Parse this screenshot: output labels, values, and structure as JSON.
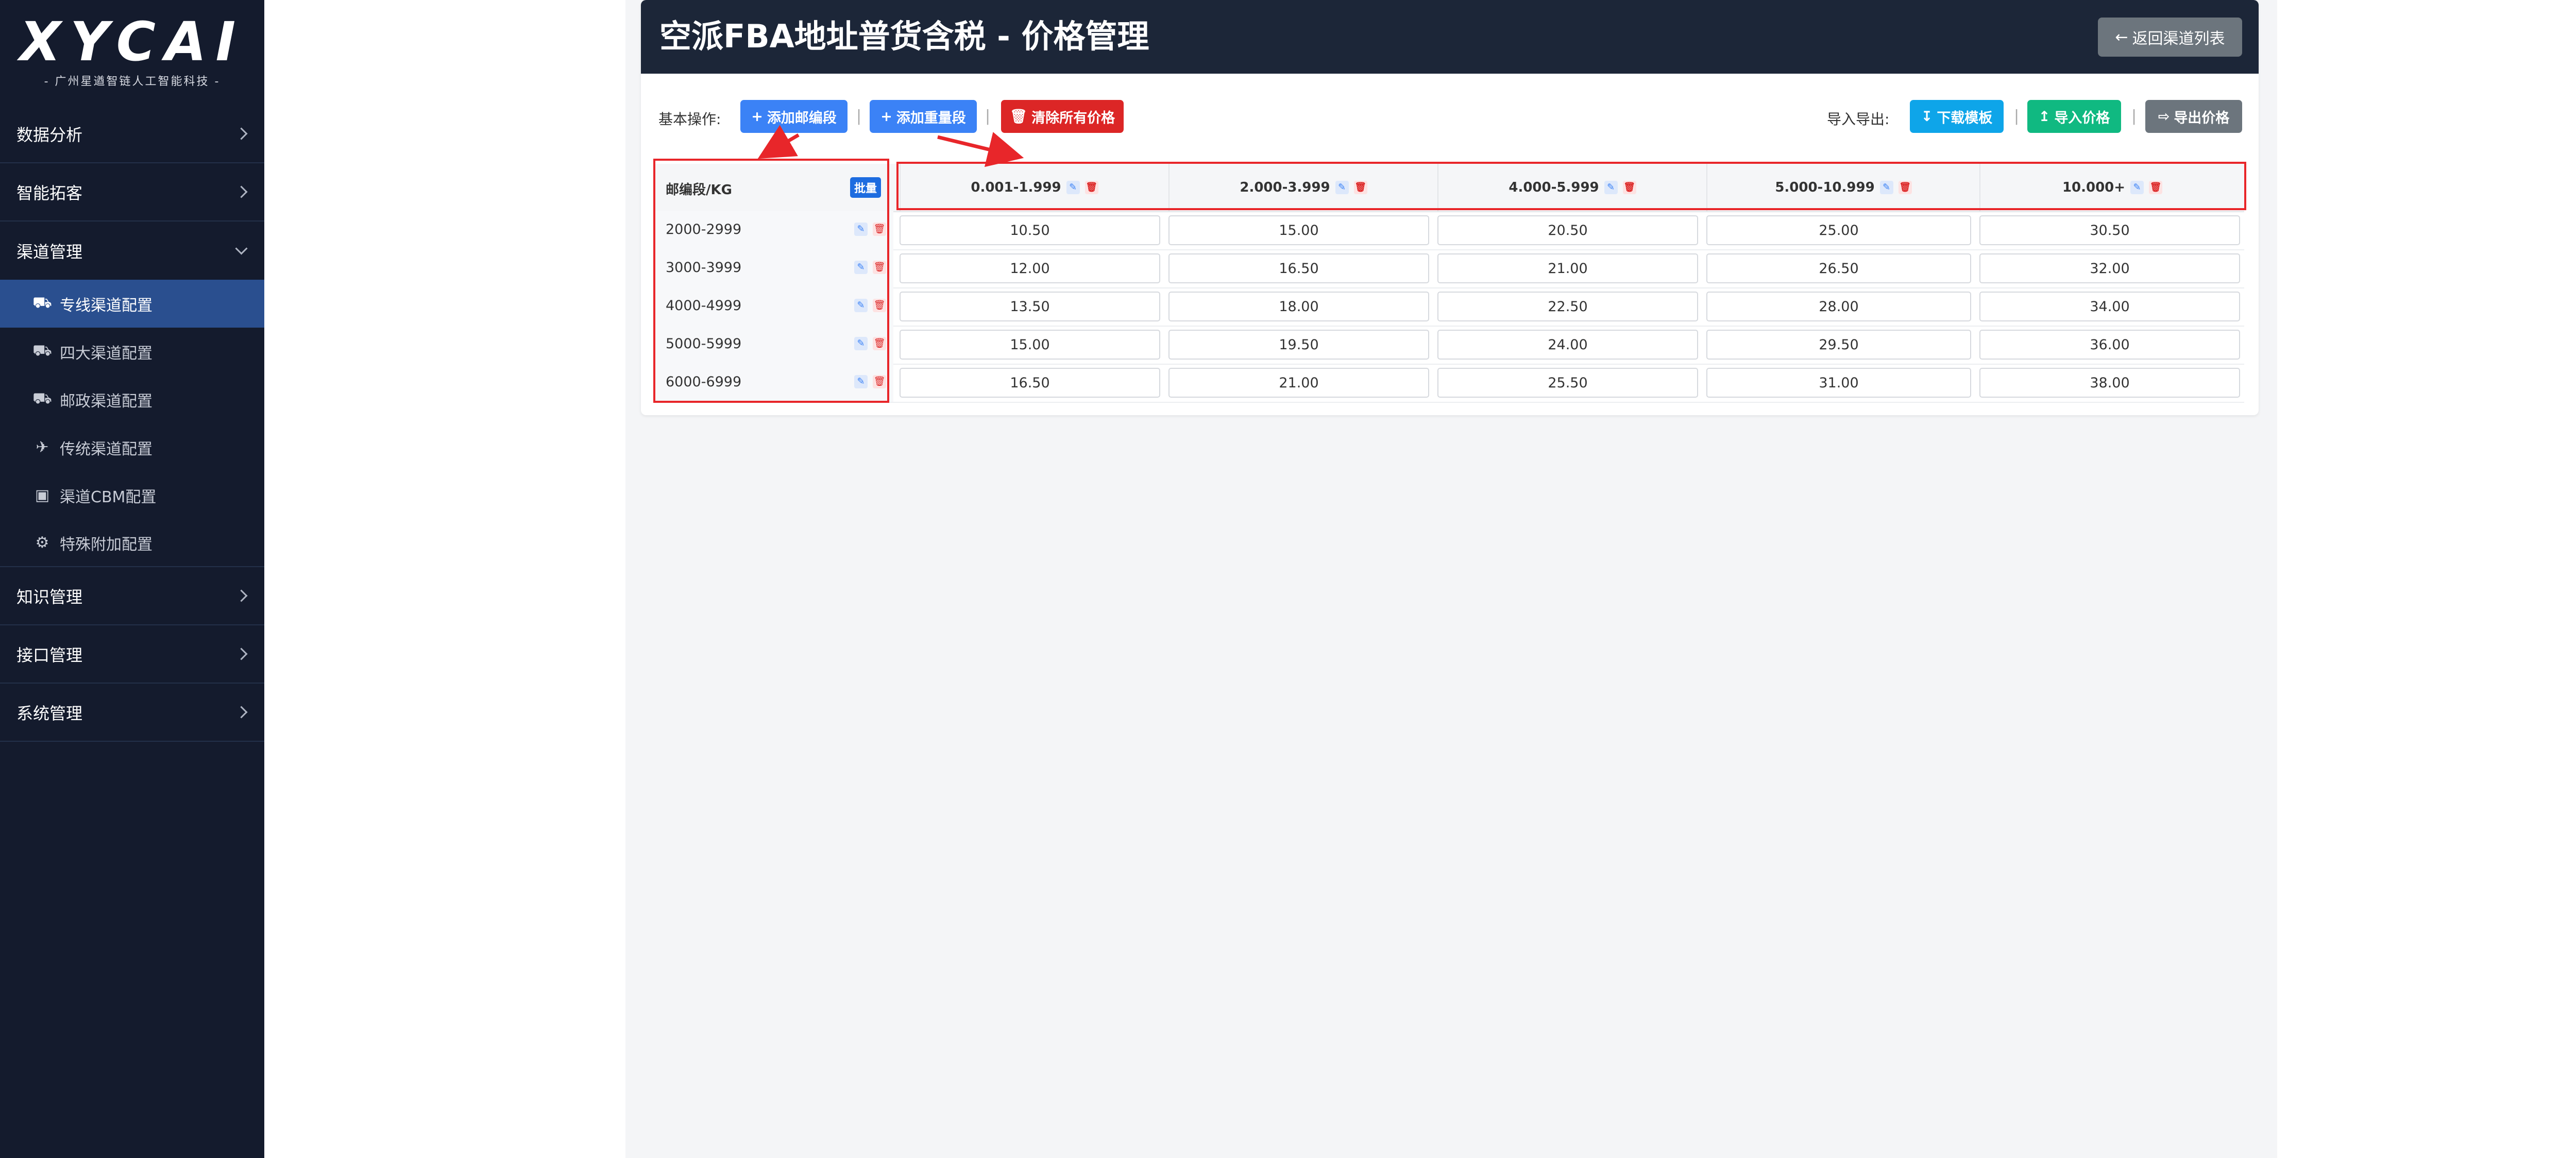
{
  "sidebar": {
    "logo": "XYCAI",
    "logo_sub": "- 广州星遒智链人工智能科技 -",
    "menu": [
      {
        "label": "数据分析",
        "icon": "chevron-right-icon"
      },
      {
        "label": "智能拓客",
        "icon": "chevron-right-icon"
      },
      {
        "label": "渠道管理",
        "icon": "chevron-down-icon",
        "expanded": true,
        "children": [
          {
            "label": "专线渠道配置",
            "icon": "truck-icon",
            "active": true
          },
          {
            "label": "四大渠道配置",
            "icon": "truck-icon"
          },
          {
            "label": "邮政渠道配置",
            "icon": "truck-icon"
          },
          {
            "label": "传统渠道配置",
            "icon": "plane-icon"
          },
          {
            "label": "渠道CBM配置",
            "icon": "cube-icon"
          },
          {
            "label": "特殊附加配置",
            "icon": "gear-icon"
          }
        ]
      },
      {
        "label": "知识管理",
        "icon": "chevron-right-icon"
      },
      {
        "label": "接口管理",
        "icon": "chevron-right-icon"
      },
      {
        "label": "系统管理",
        "icon": "chevron-right-icon"
      }
    ]
  },
  "header": {
    "title": "空派FBA地址普货含税 - 价格管理",
    "back_button": "返回渠道列表"
  },
  "toolbar": {
    "basic_label": "基本操作:",
    "add_zip": "添加邮编段",
    "add_weight": "添加重量段",
    "clear_all": "清除所有价格",
    "io_label": "导入导出:",
    "download_template": "下载模板",
    "import_price": "导入价格",
    "export_price": "导出价格",
    "separator": "|"
  },
  "table": {
    "corner_label": "邮编段/KG",
    "batch_label": "批量",
    "weight_columns": [
      "0.001-1.999",
      "2.000-3.999",
      "4.000-5.999",
      "5.000-10.999",
      "10.000+"
    ],
    "rows": [
      {
        "zip": "2000-2999",
        "prices": [
          "10.50",
          "15.00",
          "20.50",
          "25.00",
          "30.50"
        ]
      },
      {
        "zip": "3000-3999",
        "prices": [
          "12.00",
          "16.50",
          "21.00",
          "26.50",
          "32.00"
        ]
      },
      {
        "zip": "4000-4999",
        "prices": [
          "13.50",
          "18.00",
          "22.50",
          "28.00",
          "34.00"
        ]
      },
      {
        "zip": "5000-5999",
        "prices": [
          "15.00",
          "19.50",
          "24.00",
          "29.50",
          "36.00"
        ]
      },
      {
        "zip": "6000-6999",
        "prices": [
          "16.50",
          "21.00",
          "25.50",
          "31.00",
          "38.00"
        ]
      }
    ]
  },
  "colors": {
    "sidebar_bg": "#141b2d",
    "active_menu": "#2a4f8f",
    "header_bg": "#1c2638",
    "primary": "#3b82f6",
    "danger": "#dc2626",
    "info": "#0ea5e9",
    "success": "#10b981",
    "secondary": "#6c757d",
    "annotation": "#e8262a"
  }
}
